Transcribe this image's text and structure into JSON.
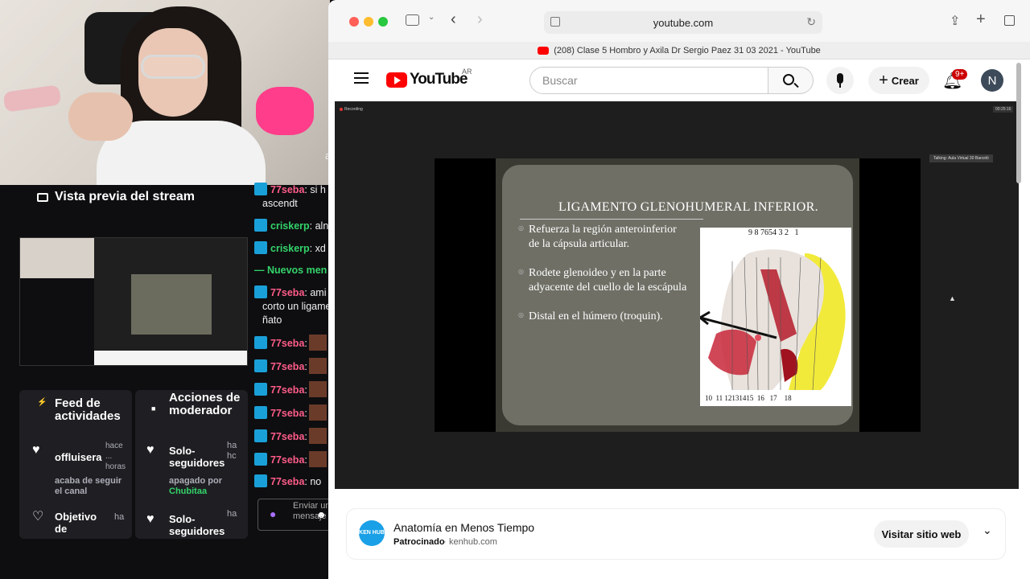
{
  "stream": {
    "preview_title": "Vista previa del stream",
    "feed_panel": {
      "title": "Feed de actividades",
      "items": [
        {
          "name": "offluisera",
          "detail": "acaba de seguir el canal",
          "time": "hace ... horas"
        },
        {
          "name": "Objetivo de",
          "detail": "",
          "time": "ha"
        }
      ]
    },
    "mod_panel": {
      "title": "Acciones de moderador",
      "items": [
        {
          "name": "Solo-seguidores",
          "detail": "apagado por",
          "actor": "Chubitaa",
          "time": "ha hc"
        },
        {
          "name": "Solo-seguidores",
          "detail": "",
          "time": "ha"
        }
      ]
    },
    "chat": [
      {
        "user": "77seba",
        "text": ": si h",
        "cont": "ascendt"
      },
      {
        "user": "criskerp",
        "text": ": aln"
      },
      {
        "user": "criskerp",
        "text": ": xd"
      },
      {
        "divider": "— Nuevos men"
      },
      {
        "user": "77seba",
        "text": ": ami",
        "cont": "corto un ligamen",
        "cont2": "ñato"
      },
      {
        "user": "77seba",
        "text": ":"
      },
      {
        "user": "77seba",
        "text": ":"
      },
      {
        "user": "77seba",
        "text": ":"
      },
      {
        "user": "77seba",
        "text": ":"
      },
      {
        "user": "77seba",
        "text": ":"
      },
      {
        "user": "77seba",
        "text": ":"
      },
      {
        "user": "77seba",
        "text": ": no"
      }
    ],
    "chat_partial_top": "al",
    "chat_input_placeholder": "Enviar un mensaje"
  },
  "browser": {
    "url": "youtube.com",
    "tab_title": "(208) Clase 5 Hombro y Axila Dr Sergio Paez 31 03 2021 - YouTube"
  },
  "youtube": {
    "logo_text": "YouTube",
    "region": "AR",
    "search_placeholder": "Buscar",
    "create_label": "Crear",
    "notifications": "9+",
    "avatar_letter": "N",
    "video": {
      "recording_label": "Recording",
      "timer": "00:25:16",
      "talking_label": "Talking: Aula Virtual 30 Barceló",
      "slide_title": "LIGAMENTO GLENOHUMERAL INFERIOR.",
      "bullets": [
        "Refuerza la región anteroinferior de la cápsula articular.",
        "Rodete glenoideo y en la parte adyacente del cuello de la escápula",
        "Distal en el húmero (troquin)."
      ],
      "figure_top_numbers": "9 8 7654 3 2   1",
      "figure_bottom_numbers": "10  11 12131415  16   17    18"
    },
    "ad": {
      "logo": "KEN HUB",
      "title": "Anatomía en Menos Tiempo",
      "sponsored": "Patrocinado",
      "domain": "kenhub.com",
      "button": "Visitar sitio web"
    }
  }
}
